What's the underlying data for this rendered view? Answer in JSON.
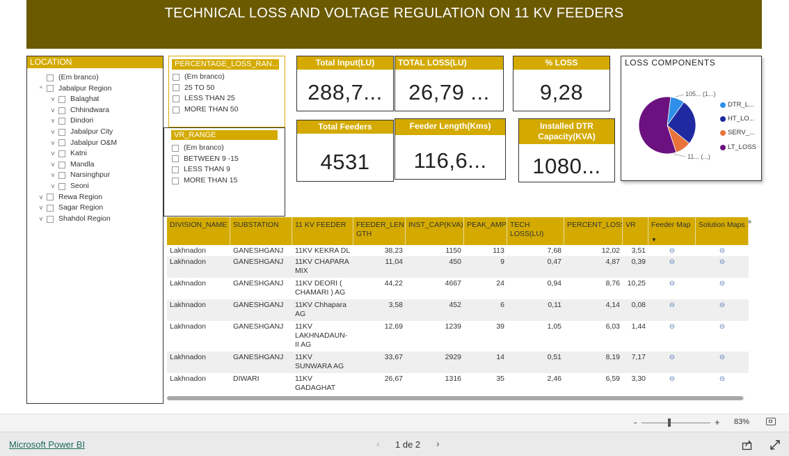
{
  "title": "TECHNICAL LOSS AND  VOLTAGE REGULATION ON 11 KV  FEEDERS",
  "location_slicer": {
    "header": "LOCATION",
    "items": [
      {
        "label": "(Em branco)",
        "level": 0,
        "chevron": ""
      },
      {
        "label": "Jabalpur Region",
        "level": 0,
        "chevron": "^"
      },
      {
        "label": "Balaghat",
        "level": 1,
        "chevron": "v"
      },
      {
        "label": "Chhindwara",
        "level": 1,
        "chevron": "v"
      },
      {
        "label": "Dindori",
        "level": 1,
        "chevron": "v"
      },
      {
        "label": "Jabalpur City",
        "level": 1,
        "chevron": "v"
      },
      {
        "label": "Jabalpur O&M",
        "level": 1,
        "chevron": "v"
      },
      {
        "label": "Katni",
        "level": 1,
        "chevron": "v"
      },
      {
        "label": "Mandla",
        "level": 1,
        "chevron": "v"
      },
      {
        "label": "Narsinghpur",
        "level": 1,
        "chevron": "v"
      },
      {
        "label": "Seoni",
        "level": 1,
        "chevron": "v"
      },
      {
        "label": "Rewa Region",
        "level": 0,
        "chevron": "v"
      },
      {
        "label": "Sagar Region",
        "level": 0,
        "chevron": "v"
      },
      {
        "label": "Shahdol Region",
        "level": 0,
        "chevron": "v"
      }
    ]
  },
  "loss_range_slicer": {
    "header": "PERCENTAGE_LOSS_RAN...",
    "items": [
      "(Em branco)",
      "25 TO 50",
      "LESS THAN 25",
      "MORE THAN 50"
    ]
  },
  "vr_range_slicer": {
    "header": "VR_RANGE",
    "items": [
      "(Em branco)",
      "BETWEEN 9 -15",
      "LESS THAN 9",
      "MORE THAN 15"
    ]
  },
  "cards": {
    "total_input": {
      "title": "Total Input(LU)",
      "value": "288,7..."
    },
    "total_loss": {
      "title": "TOTAL LOSS(LU)",
      "value": "26,79 ..."
    },
    "pct_loss": {
      "title": "% LOSS",
      "value": "9,28"
    },
    "total_feeders": {
      "title": "Total Feeders",
      "value": "4531"
    },
    "feeder_length": {
      "title": "Feeder Length(Kms)",
      "value": "116,6..."
    },
    "installed_dtr": {
      "title_line1": "Installed DTR",
      "title_line2": "Capacity(KVA)",
      "value": "1080..."
    }
  },
  "loss_components": {
    "title": "LOSS COMPONENTS",
    "top_label": "105... (1...)",
    "bottom_label": "11... (...)",
    "legend": [
      {
        "label": "DTR_L...",
        "color": "#2e8fe8"
      },
      {
        "label": "HT_LO...",
        "color": "#1f2aa0"
      },
      {
        "label": "SERV_...",
        "color": "#e8743b"
      },
      {
        "label": "LT_LOSS",
        "color": "#6b1280"
      }
    ]
  },
  "chart_data": {
    "type": "pie",
    "title": "LOSS COMPONENTS",
    "labels": [
      "DTR_L...",
      "HT_LO...",
      "SERV_...",
      "LT_LOSS"
    ],
    "values": [
      8,
      26,
      9,
      57
    ]
  },
  "table": {
    "headers": [
      "DIVISION_NAME",
      "SUBSTATION",
      "11 KV FEEDER",
      "FEEDER_LEN GTH",
      "INST_CAP(KVA)",
      "PEAK_AMP",
      "TECH LOSS(LU)",
      "PERCENT_LOSS",
      "VR",
      "Feeder Map",
      "Solution Maps"
    ],
    "rows": [
      [
        "Lakhnadon",
        "GANESHGANJ",
        "11KV KEKRA DL",
        "38,23",
        "1150",
        "113",
        "7,68",
        "12,02",
        "3,51"
      ],
      [
        "Lakhnadon",
        "GANESHGANJ",
        "11KV CHAPARA MIX",
        "11,04",
        "450",
        "9",
        "0,47",
        "4,87",
        "0,39"
      ],
      [
        "Lakhnadon",
        "GANESHGANJ",
        "11KV DEORI ( CHAMARI ) AG",
        "44,22",
        "4667",
        "24",
        "0,94",
        "8,76",
        "10,25"
      ],
      [
        "Lakhnadon",
        "GANESHGANJ",
        "11KV Chhapara AG",
        "3,58",
        "452",
        "6",
        "0,11",
        "4,14",
        "0,08"
      ],
      [
        "Lakhnadon",
        "GANESHGANJ",
        "11KV LAKHNADAUN-II AG",
        "12,69",
        "1239",
        "39",
        "1,05",
        "6,03",
        "1,44"
      ],
      [
        "Lakhnadon",
        "GANESHGANJ",
        "11KV SUNWARA AG",
        "33,67",
        "2929",
        "14",
        "0,51",
        "8,19",
        "7,17"
      ],
      [
        "Lakhnadon",
        "DIWARI",
        "11KV GADAGHAT",
        "26,67",
        "1316",
        "35",
        "2,46",
        "6,59",
        "3,30"
      ]
    ],
    "link_glyph": "⊖",
    "sort_glyph": "▼"
  },
  "zoom": {
    "minus": "-",
    "plus": "+",
    "level": "83%"
  },
  "footer": {
    "brand": "Microsoft Power BI",
    "page": "1 de 2",
    "prev": "‹",
    "next": "›"
  }
}
